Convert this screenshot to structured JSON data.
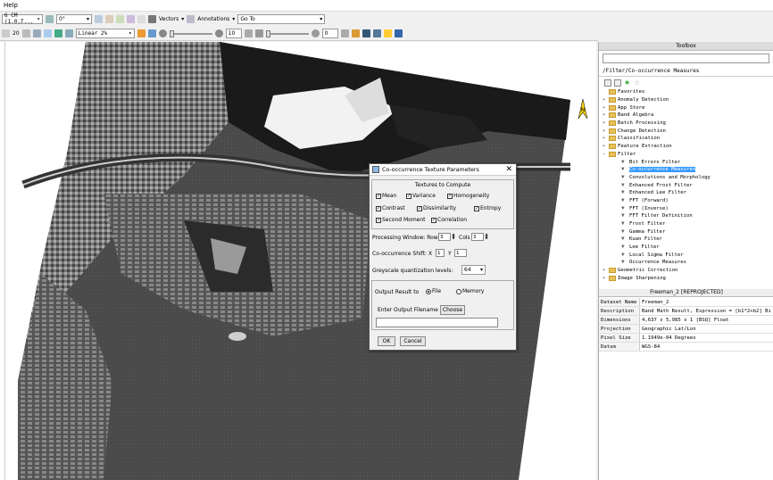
{
  "menubar": {
    "help_label": "Help"
  },
  "toolbar1": {
    "layer_combo": "6 CM (1.0.T...",
    "zoom_combo": "0°",
    "vectors_label": "Vectors",
    "annotations_label": "Annotations",
    "goto_placeholder": "Go To"
  },
  "toolbar2": {
    "zoom_value": "20",
    "stretch_combo": "Linear 2%",
    "brightness_value": "10",
    "contrast_value": "0"
  },
  "toolbox": {
    "title": "Toolbox",
    "path": "/Filter/Co-occurrence Measures",
    "tree": [
      {
        "label": "Favorites",
        "kind": "folder",
        "level": 0,
        "pm": ""
      },
      {
        "label": "Anomaly Detection",
        "kind": "folder",
        "level": 0,
        "pm": "+"
      },
      {
        "label": "App Store",
        "kind": "folder",
        "level": 0,
        "pm": "+"
      },
      {
        "label": "Band Algebra",
        "kind": "folder",
        "level": 0,
        "pm": "+"
      },
      {
        "label": "Batch Processing",
        "kind": "folder",
        "level": 0,
        "pm": "+"
      },
      {
        "label": "Change Detection",
        "kind": "folder",
        "level": 0,
        "pm": "+"
      },
      {
        "label": "Classification",
        "kind": "folder",
        "level": 0,
        "pm": "+"
      },
      {
        "label": "Feature Extraction",
        "kind": "folder",
        "level": 0,
        "pm": "+"
      },
      {
        "label": "Filter",
        "kind": "folder",
        "level": 0,
        "pm": "−"
      },
      {
        "label": "Bit Errors Filter",
        "kind": "tool",
        "level": 1,
        "pm": ""
      },
      {
        "label": "Co-occurrence Measures",
        "kind": "tool",
        "level": 1,
        "pm": "",
        "selected": true
      },
      {
        "label": "Convolutions and Morphology",
        "kind": "tool",
        "level": 1,
        "pm": ""
      },
      {
        "label": "Enhanced Frost Filter",
        "kind": "tool",
        "level": 1,
        "pm": ""
      },
      {
        "label": "Enhanced Lee Filter",
        "kind": "tool",
        "level": 1,
        "pm": ""
      },
      {
        "label": "FFT (Forward)",
        "kind": "tool",
        "level": 1,
        "pm": ""
      },
      {
        "label": "FFT (Inverse)",
        "kind": "tool",
        "level": 1,
        "pm": ""
      },
      {
        "label": "FFT Filter Definition",
        "kind": "tool",
        "level": 1,
        "pm": ""
      },
      {
        "label": "Frost Filter",
        "kind": "tool",
        "level": 1,
        "pm": ""
      },
      {
        "label": "Gamma Filter",
        "kind": "tool",
        "level": 1,
        "pm": ""
      },
      {
        "label": "Kuan Filter",
        "kind": "tool",
        "level": 1,
        "pm": ""
      },
      {
        "label": "Lee Filter",
        "kind": "tool",
        "level": 1,
        "pm": ""
      },
      {
        "label": "Local Sigma Filter",
        "kind": "tool",
        "level": 1,
        "pm": ""
      },
      {
        "label": "Occurrence Measures",
        "kind": "tool",
        "level": 1,
        "pm": ""
      },
      {
        "label": "Geometric Correction",
        "kind": "folder",
        "level": 0,
        "pm": "+"
      },
      {
        "label": "Image Sharpening",
        "kind": "folder",
        "level": 0,
        "pm": "+"
      }
    ]
  },
  "properties": {
    "title": "Freeman_2 [REPROJECTED]",
    "rows": [
      {
        "key": "Dataset Name",
        "value": "Freeman_2"
      },
      {
        "key": "Description",
        "value": "Band Math Result, Expression = [b1*2+b2] Bi"
      },
      {
        "key": "Dimensions",
        "value": "4,637 x 5,985 x 1 [BSQ] Float"
      },
      {
        "key": "Projection",
        "value": "Geographic Lat/Lon"
      },
      {
        "key": "Pixel Size",
        "value": "1.1949e-04 Degrees"
      },
      {
        "key": "Datum",
        "value": "WGS-84"
      }
    ]
  },
  "dialog": {
    "title": "Co-occurrence Texture Parameters",
    "textures_label": "Textures to Compute",
    "checks": {
      "mean": "Mean",
      "variance": "Variance",
      "homogeneity": "Homogeneity",
      "contrast": "Contrast",
      "dissimilarity": "Dissimilarity",
      "entropy": "Entropy",
      "second_moment": "Second Moment",
      "correlation": "Correlation"
    },
    "window_label": "Processing Window: Rows",
    "rows_value": "3",
    "cols_label": "Cols",
    "cols_value": "3",
    "shift_label": "Co-occurrence Shift: X",
    "shift_x": "1",
    "shift_y_label": "Y",
    "shift_y": "1",
    "greyscale_label": "Greyscale quantization levels:",
    "greyscale_value": "64",
    "output_label": "Output Result to",
    "file_label": "File",
    "memory_label": "Memory",
    "filename_label": "Enter Output Filename",
    "choose_label": "Choose",
    "ok_label": "OK",
    "cancel_label": "Cancel",
    "close_symbol": "✕"
  },
  "viewer": {
    "north_label": "N"
  }
}
